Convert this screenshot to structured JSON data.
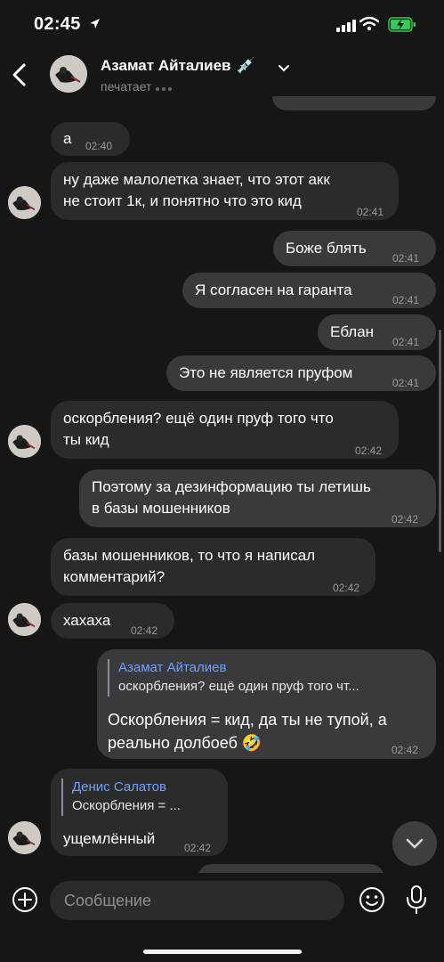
{
  "status_bar": {
    "time": "02:45"
  },
  "header": {
    "name": "Азамат Айталиев",
    "name_emoji": "💉",
    "status": "печатает"
  },
  "messages": [
    {
      "text": "а",
      "time": "02:40"
    },
    {
      "text": "ну даже малолетка знает, что этот акк\nне стоит 1к, и понятно что это кид",
      "time": "02:41"
    },
    {
      "text": "Боже блять",
      "time": "02:41"
    },
    {
      "text": "Я согласен на гаранта",
      "time": "02:41"
    },
    {
      "text": "Еблан",
      "time": "02:41"
    },
    {
      "text": "Это не является пруфом",
      "time": "02:41"
    },
    {
      "text": "оскорбления? ещё один пруф того что\nты кид",
      "time": "02:42"
    },
    {
      "text": "Поэтому за дезинформацию ты летишь\nв базы мошенников",
      "time": "02:42"
    },
    {
      "text": "базы мошенников, то что я написал\nкомментарий?",
      "time": "02:42"
    },
    {
      "text": "хахаха",
      "time": "02:42"
    },
    {
      "reply_name": "Азамат Айталиев",
      "reply_text": "оскорбления? ещё один пруф того чт...",
      "text": "Оскорбления = кид, да ты не тупой, а\nреально долбоеб 🤣",
      "time": "02:42"
    },
    {
      "reply_name": "Денис Салатов",
      "reply_text": "Оскорбления = ...",
      "text": "ущемлённый",
      "time": "02:42"
    }
  ],
  "input": {
    "placeholder": "Сообщение"
  },
  "colors": {
    "background": "#161616",
    "bubble_in": "#2b2b2c",
    "bubble_out": "#3a3a3c",
    "accent": "#6ea1ff",
    "battery": "#34c759"
  },
  "icons": [
    "location-arrow-icon",
    "signal-icon",
    "wifi-icon",
    "battery-charging-icon",
    "back-chevron-icon",
    "chevron-down-icon",
    "chevron-down-circle-icon",
    "plus-icon",
    "smile-icon",
    "mic-icon"
  ]
}
